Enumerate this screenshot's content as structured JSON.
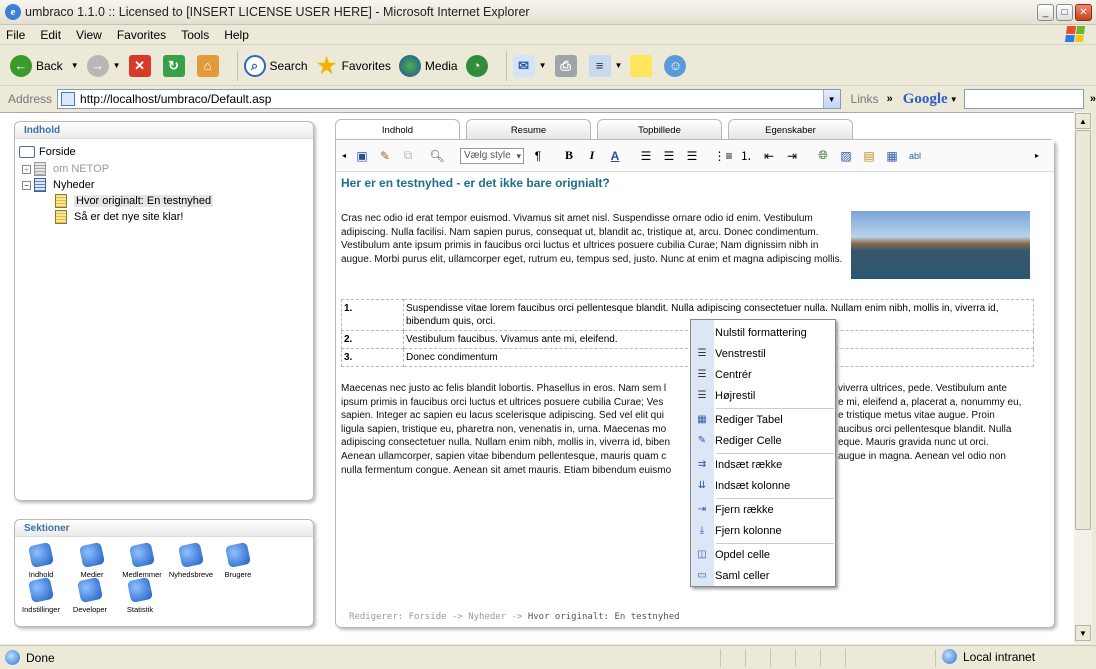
{
  "window": {
    "title": "umbraco 1.1.0 :: Licensed to [INSERT LICENSE USER HERE] - Microsoft Internet Explorer"
  },
  "menu": [
    "File",
    "Edit",
    "View",
    "Favorites",
    "Tools",
    "Help"
  ],
  "toolbar": {
    "back": "Back",
    "search": "Search",
    "favorites": "Favorites",
    "media": "Media"
  },
  "address": {
    "label": "Address",
    "url": "http://localhost/umbraco/Default.asp",
    "links": "Links",
    "google": "Google"
  },
  "content_panel": {
    "header": "Indhold",
    "tree": [
      "Forside",
      "om NETOP",
      "Nyheder",
      "Hvor originalt: En testnyhed",
      "Så er det nye site klar!"
    ]
  },
  "sections": {
    "header": "Sektioner",
    "items": [
      "Indhold",
      "Medier",
      "Medlemmer",
      "Nyhedsbreve",
      "Brugere",
      "Indstillinger",
      "Developer",
      "Statistik"
    ]
  },
  "tabs": [
    "Indhold",
    "Resume",
    "Topbillede",
    "Egenskaber"
  ],
  "editor": {
    "style_select": "Vælg style",
    "heading": "Her er en testnyhed - er det ikke bare orignialt?",
    "para1": "Cras nec odio id erat tempor euismod. Vivamus sit amet nisl. Suspendisse ornare odio id enim. Vestibulum adipiscing. Nulla facilisi. Nam sapien purus, consequat ut, blandit ac, tristique at, arcu. Donec condimentum. Vestibulum ante ipsum primis in faucibus orci luctus et ultrices posuere cubilia Curae; Nam dignissim nibh in augue. Morbi purus elit, ullamcorper eget, rutrum eu, tempus sed, justo. Nunc at enim et magna adipiscing mollis.",
    "table": [
      {
        "n": "1.",
        "text": "Suspendisse vitae lorem faucibus orci pellentesque blandit. Nulla adipiscing consectetuer nulla. Nullam enim nibh, mollis in, viverra id, bibendum quis, orci."
      },
      {
        "n": "2.",
        "text": "Vestibulum faucibus. Vivamus ante mi, eleifend."
      },
      {
        "n": "3.",
        "text": "Donec condimentum"
      }
    ],
    "para2_left": "Maecenas nec justo ac felis blandit lobortis. Phasellus in eros. Nam sem l\nipsum primis in faucibus orci luctus et ultrices posuere cubilia Curae; Ves\nsapien. Integer ac sapien eu lacus scelerisque adipiscing. Sed vel elit qui\nligula sapien, tristique eu, pharetra non, venenatis in, urna. Maecenas mo\nadipiscing consectetuer nulla. Nullam enim nibh, mollis in, viverra id, biben\nAenean ullamcorper, sapien vitae bibendum pellentesque, mauris quam c\nnulla fermentum congue. Aenean sit amet mauris. Etiam bibendum euismo",
    "para2_right": "viverra ultrices, pede. Vestibulum ante\ne mi, eleifend a, placerat a, nonummy eu,\ne tristique metus vitae augue. Proin\naucibus orci pellentesque blandit. Nulla\neque. Mauris gravida nunc ut orci.\naugue in magna. Aenean vel odio non",
    "crumb_prefix": "Redigerer: Forside -> Nyheder ->",
    "crumb_current": "Hvor originalt: En testnyhed"
  },
  "context_menu": [
    "Nulstil formattering",
    "Venstrestil",
    "Centrér",
    "Højrestil",
    "Rediger Tabel",
    "Rediger Celle",
    "Indsæt række",
    "Indsæt kolonne",
    "Fjern række",
    "Fjern kolonne",
    "Opdel celle",
    "Saml celler"
  ],
  "status": {
    "text": "Done",
    "zone": "Local intranet"
  }
}
